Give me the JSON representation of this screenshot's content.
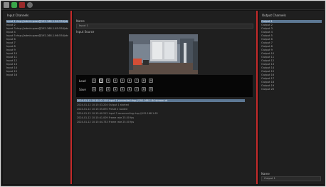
{
  "toolbar": {
    "icons": [
      "camera-icon",
      "play-icon",
      "stop-icon",
      "settings-icon"
    ]
  },
  "left_panel": {
    "title": "Input Channels",
    "items": [
      {
        "label": "Input 1 rtsp://admin:pass@192.168.1.64:554/stream",
        "selected": true
      },
      {
        "label": "Input 2",
        "selected": false
      },
      {
        "label": "Input 3 rtsp://admin:pass@192.168.1.65:554/stream",
        "selected": false
      },
      {
        "label": "Input 4",
        "selected": false
      },
      {
        "label": "Input 5 rtsp://admin:pass@192.168.1.66:554/stream",
        "selected": false
      },
      {
        "label": "Input 6",
        "selected": false
      },
      {
        "label": "Input 7",
        "selected": false
      },
      {
        "label": "Input 8",
        "selected": false
      },
      {
        "label": "Input 9",
        "selected": false
      },
      {
        "label": "Input 10",
        "selected": false
      },
      {
        "label": "Input 11",
        "selected": false
      },
      {
        "label": "Input 12",
        "selected": false
      },
      {
        "label": "Input 13",
        "selected": false
      },
      {
        "label": "Input 14",
        "selected": false
      },
      {
        "label": "Input 15",
        "selected": false
      },
      {
        "label": "Input 16",
        "selected": false
      }
    ]
  },
  "center_panel": {
    "name_label": "Name",
    "name_value": "Input 1",
    "source_label": "Input Source",
    "load_label": "Load",
    "save_label": "Save",
    "presets": [
      "1",
      "2",
      "3",
      "4",
      "5",
      "6",
      "7",
      "8",
      "9"
    ],
    "active_preset_index": 1,
    "log": [
      {
        "text": "2024-01-12 10:15:32.118 Input 1 connected rtsp://192.168.1.64 stream ok",
        "selected": true
      },
      {
        "text": "2024-01-12 10:15:33.204 Output 1 started",
        "selected": false
      },
      {
        "text": "2024-01-12 10:15:35.870 Preset 2 loaded",
        "selected": false
      },
      {
        "text": "2024-01-12 10:15:40.512 Input 3 reconnecting rtsp://192.168.1.65",
        "selected": false
      },
      {
        "text": "2024-01-12 10:15:41.009 Frame rate 25.00 fps",
        "selected": false
      },
      {
        "text": "2024-01-12 10:15:44.733 Frame rate 25.00 fps",
        "selected": false
      }
    ]
  },
  "right_panel": {
    "title": "Output Channels",
    "items": [
      {
        "label": "Output 1",
        "selected": true
      },
      {
        "label": "Output 2",
        "selected": false
      },
      {
        "label": "Output 3",
        "selected": false
      },
      {
        "label": "Output 4",
        "selected": false
      },
      {
        "label": "Output 5",
        "selected": false
      },
      {
        "label": "Output 6",
        "selected": false
      },
      {
        "label": "Output 7",
        "selected": false
      },
      {
        "label": "Output 8",
        "selected": false
      },
      {
        "label": "Output 9",
        "selected": false
      },
      {
        "label": "Output 10",
        "selected": false
      },
      {
        "label": "Output 11",
        "selected": false
      },
      {
        "label": "Output 12",
        "selected": false
      },
      {
        "label": "Output 13",
        "selected": false
      },
      {
        "label": "Output 14",
        "selected": false
      },
      {
        "label": "Output 15",
        "selected": false
      },
      {
        "label": "Output 16",
        "selected": false
      },
      {
        "label": "Output 17",
        "selected": false
      },
      {
        "label": "Output 18",
        "selected": false
      },
      {
        "label": "Output 19",
        "selected": false
      },
      {
        "label": "Output 20",
        "selected": false
      }
    ],
    "name_label": "Name",
    "name_value": "Output 1"
  },
  "colors": {
    "accent_red": "#c42a2a",
    "selection_blue": "#5d7894",
    "panel_bg": "#1f1f1f"
  }
}
